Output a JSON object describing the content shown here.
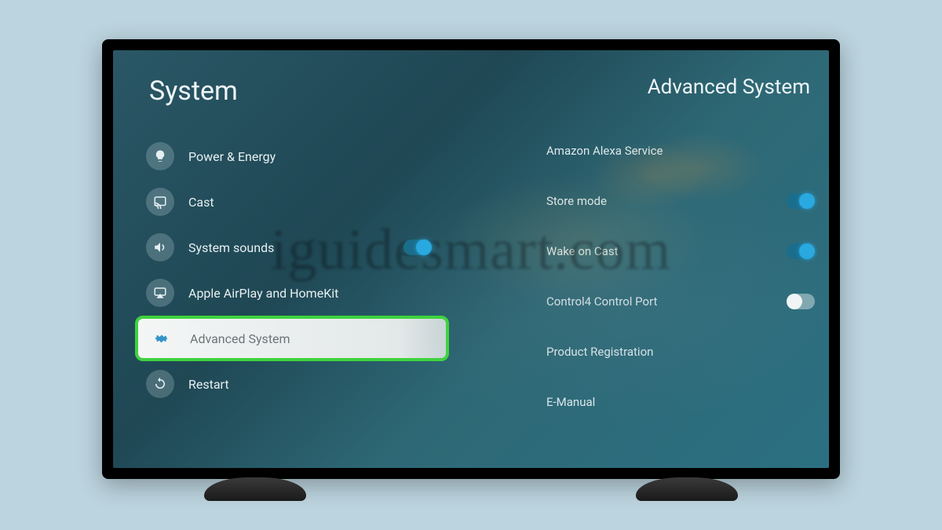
{
  "watermark": "iguidesmart.com",
  "left": {
    "title": "System",
    "items": [
      {
        "id": "power-energy",
        "label": "Power & Energy",
        "icon": "bulb",
        "toggle": null,
        "selected": false
      },
      {
        "id": "cast",
        "label": "Cast",
        "icon": "cast",
        "toggle": null,
        "selected": false
      },
      {
        "id": "system-sounds",
        "label": "System sounds",
        "icon": "speaker",
        "toggle": "on",
        "selected": false
      },
      {
        "id": "airplay-homekit",
        "label": "Apple AirPlay and HomeKit",
        "icon": "airplay",
        "toggle": null,
        "selected": false
      },
      {
        "id": "advanced-system",
        "label": "Advanced System",
        "icon": "gear",
        "toggle": null,
        "selected": true
      },
      {
        "id": "restart",
        "label": "Restart",
        "icon": "restart",
        "toggle": null,
        "selected": false
      }
    ]
  },
  "right": {
    "title": "Advanced System",
    "items": [
      {
        "id": "alexa",
        "label": "Amazon Alexa Service",
        "toggle": null
      },
      {
        "id": "store-mode",
        "label": "Store mode",
        "toggle": "on"
      },
      {
        "id": "wake-cast",
        "label": "Wake on Cast",
        "toggle": "on"
      },
      {
        "id": "control4",
        "label": "Control4 Control Port",
        "toggle": "off-white"
      },
      {
        "id": "prod-reg",
        "label": "Product Registration",
        "toggle": null
      },
      {
        "id": "emanual",
        "label": "E-Manual",
        "toggle": null
      }
    ]
  }
}
